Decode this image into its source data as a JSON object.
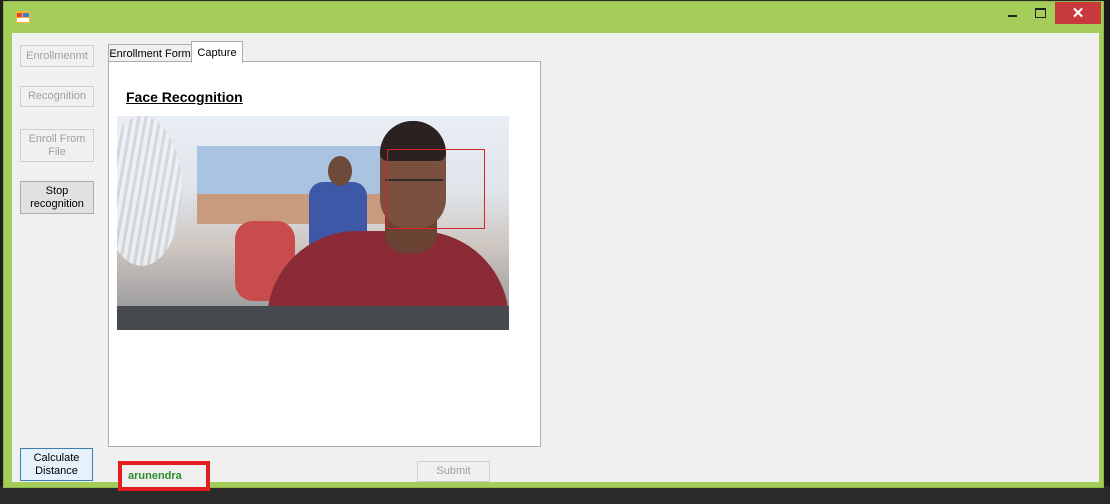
{
  "window": {
    "controls": {
      "minimize_icon": "minimize-icon",
      "maximize_icon": "maximize-icon",
      "close_icon": "✕"
    }
  },
  "sidebar": {
    "enrollment_label": "Enrollmenmt",
    "recognition_label": "Recognition",
    "enroll_from_file_label": "Enroll From File",
    "stop_recognition_label": "Stop recognition",
    "calculate_distance_label": "Calculate Distance"
  },
  "tabs": [
    {
      "label": "Enrollment Form",
      "active": false
    },
    {
      "label": "Capture",
      "active": true
    }
  ],
  "capture": {
    "title": "Face Recognition"
  },
  "result": {
    "recognized_name": "arunendra"
  },
  "footer": {
    "submit_label": "Submit"
  },
  "colors": {
    "titlebar": "#a4cd5a",
    "close": "#c7393b",
    "highlight_border": "#e31e24",
    "name_text": "#2e8b2e",
    "face_box": "#d8232a"
  }
}
